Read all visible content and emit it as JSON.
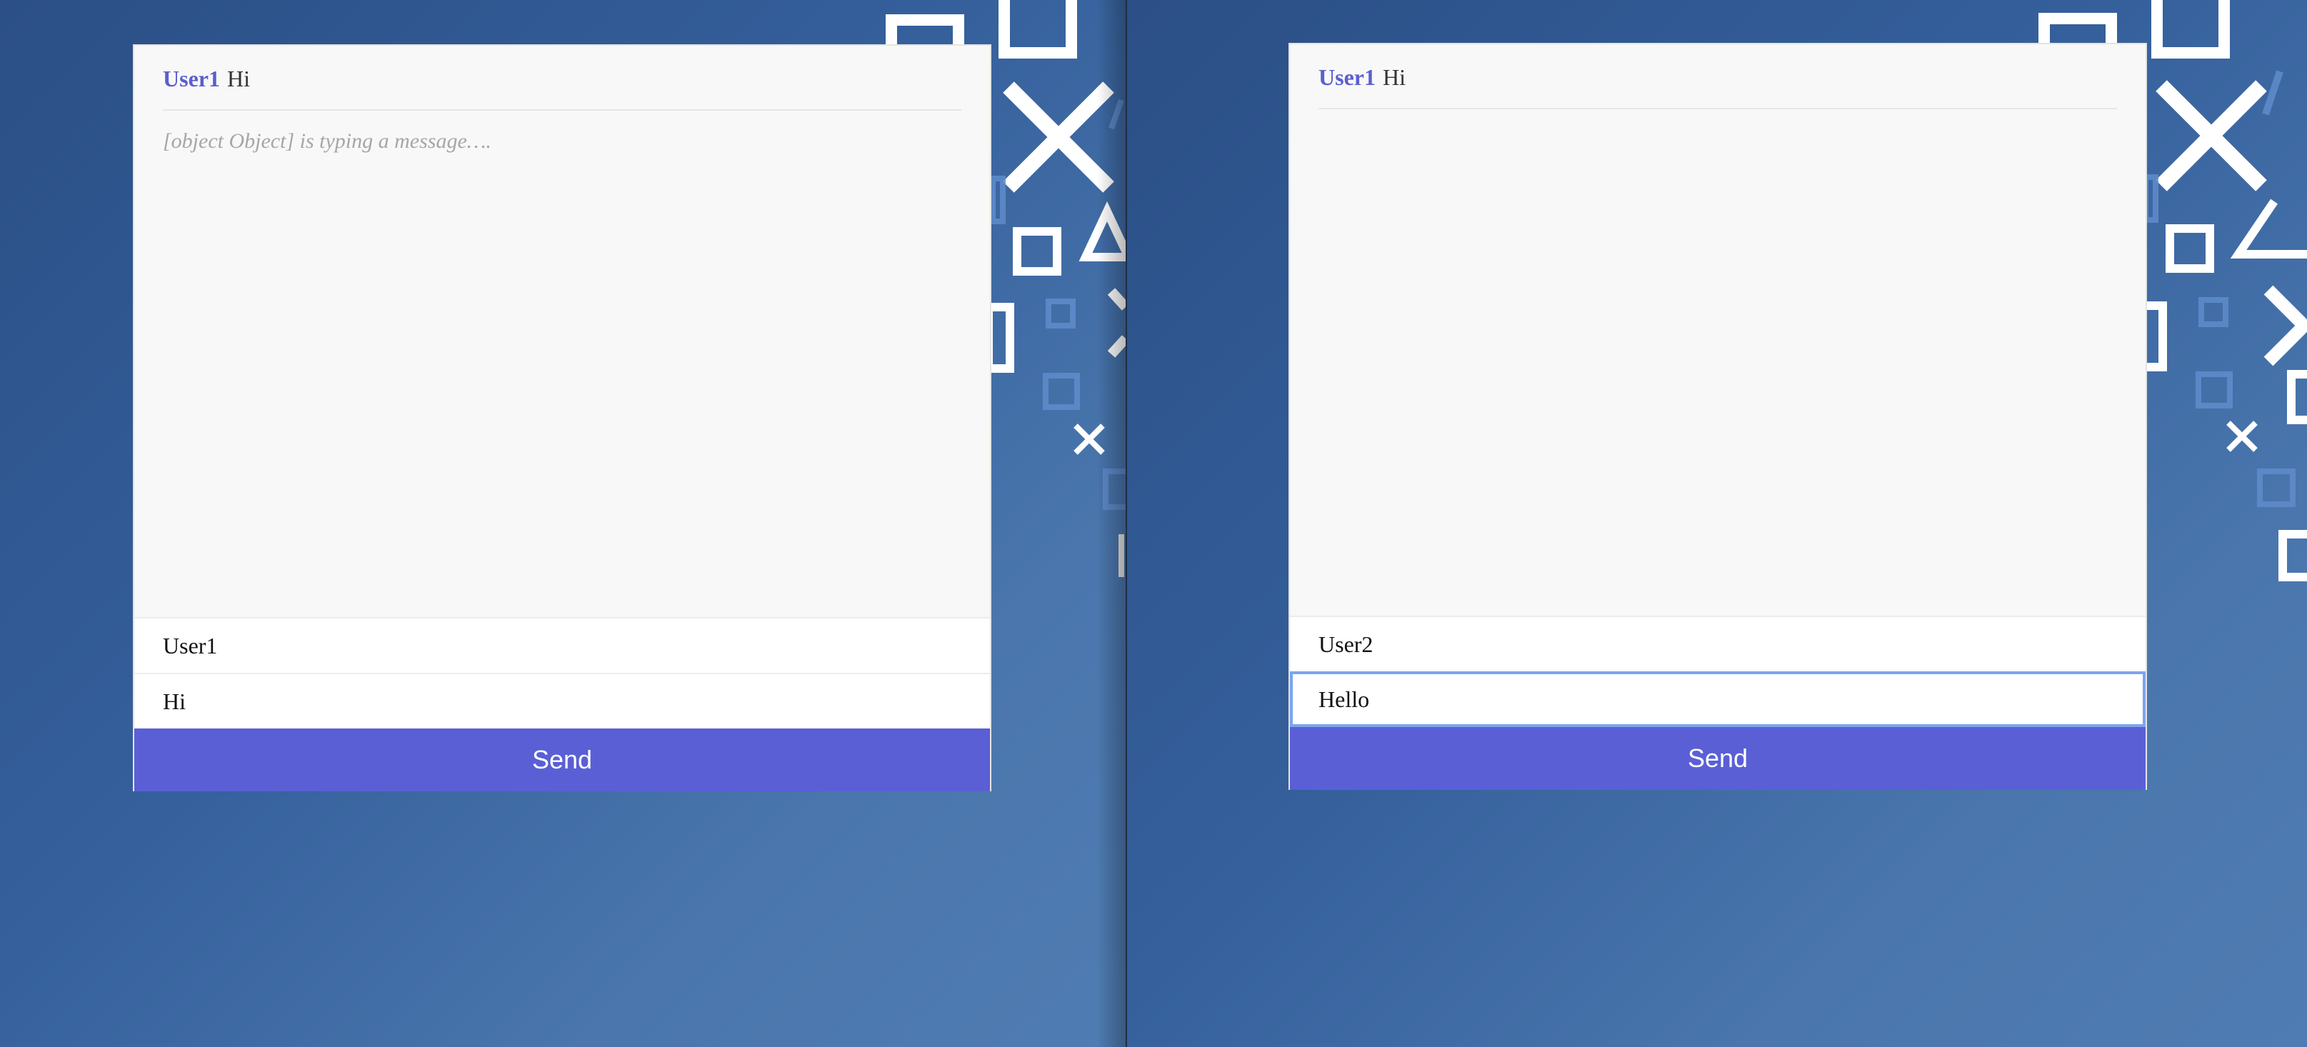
{
  "windows": [
    {
      "messages": [
        {
          "handle": "User1",
          "text": "Hi"
        }
      ],
      "typing_indicator": "[object Object] is typing a message….",
      "handle_input": {
        "value": "User1"
      },
      "message_input": {
        "value": "Hi"
      },
      "send_label": "Send"
    },
    {
      "messages": [
        {
          "handle": "User1",
          "text": "Hi"
        }
      ],
      "typing_indicator": "",
      "handle_input": {
        "value": "User2"
      },
      "message_input": {
        "value": "Hello"
      },
      "send_label": "Send"
    }
  ],
  "colors": {
    "accent": "#5a5fd6",
    "handle": "#5a5fcf",
    "background": "#35609c",
    "focus_ring": "#7fa3ee"
  },
  "decorations": [
    "square-icon",
    "cross-icon",
    "triangle-icon"
  ]
}
